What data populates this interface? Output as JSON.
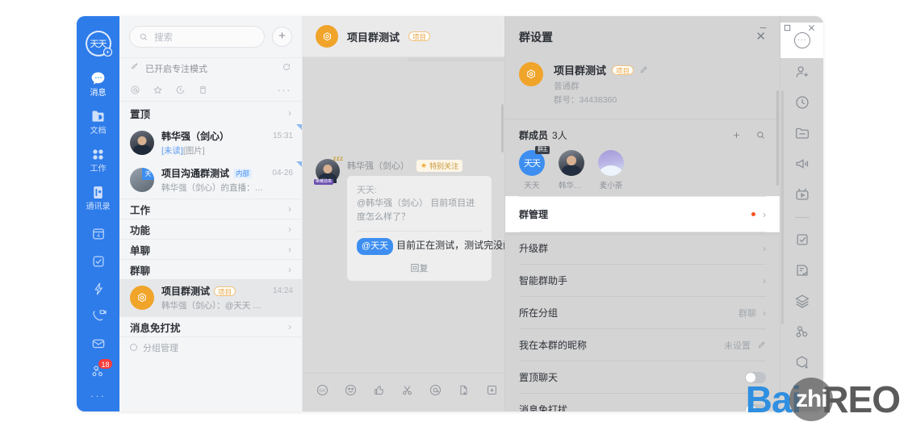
{
  "window": {
    "controls": {
      "minimize": "–",
      "maximize": "□",
      "close": "✕"
    }
  },
  "rail": {
    "avatar_text": "天天",
    "items": [
      {
        "label": "消息",
        "icon": "chat-icon",
        "active": true
      },
      {
        "label": "文档",
        "icon": "docs-icon",
        "active": false
      },
      {
        "label": "工作",
        "icon": "work-grid-icon",
        "active": false
      },
      {
        "label": "通讯录",
        "icon": "contacts-icon",
        "active": false
      }
    ],
    "mini_items": [
      {
        "icon": "calendar-icon",
        "badge": ""
      },
      {
        "icon": "checkbox-task-icon",
        "badge": ""
      },
      {
        "icon": "lightning-icon",
        "badge": ""
      },
      {
        "icon": "video-call-icon",
        "badge": ""
      },
      {
        "icon": "mail-icon",
        "badge": ""
      },
      {
        "icon": "team-icon",
        "badge": "18"
      }
    ],
    "more": "···"
  },
  "chatlist": {
    "search_placeholder": "搜索",
    "add_label": "+",
    "focus_mode": "已开启专注模式",
    "filters": [
      "at-icon",
      "star-icon",
      "clock-icon",
      "archive-icon"
    ],
    "filter_more": "···",
    "pinned_header": "置顶",
    "pinned": [
      {
        "name": "韩华强（剑心）",
        "tag": "",
        "preview_unread": "[未读]",
        "preview": "[图片]",
        "time": "15:31",
        "avatar": "photo1"
      },
      {
        "name": "项目沟通群测试",
        "tag": "内部",
        "preview_unread": "",
        "preview": "韩华强（剑心）的直播：直播测试 已...",
        "time": "04-26",
        "avatar": "photo2"
      }
    ],
    "sections": [
      {
        "label": "工作"
      },
      {
        "label": "功能"
      },
      {
        "label": "单聊"
      },
      {
        "label": "群聊"
      }
    ],
    "selected_chat": {
      "name": "项目群测试",
      "tag": "项目",
      "preview": "韩华强（剑心）：@天天 目前正在测试...",
      "time": "14:24",
      "avatar": "orange-group"
    },
    "dnd_section": "消息免打扰",
    "group_manage": "分组管理"
  },
  "chat": {
    "header": {
      "title": "项目群测试",
      "tag": "项目"
    },
    "message": {
      "sender": "韩华强（剑心）",
      "special_tag": "特别关注",
      "quote_name": "天天:",
      "quote_text": "@韩华强（剑心） 目前项目进度怎么样了？",
      "mention": "@天天",
      "text": "目前正在测试，测试完没问题就能",
      "reply_label": "回复"
    },
    "toolbar": [
      "gif-icon",
      "emoji-icon",
      "thumbs-up-icon",
      "scissors-icon",
      "at-icon",
      "file-send-icon",
      "screenshot-icon",
      "task-check-icon",
      "lightning-icon"
    ]
  },
  "settings": {
    "title": "群设置",
    "close": "✕",
    "group": {
      "name": "项目群测试",
      "tag": "项目",
      "edit_icon": "pencil-icon",
      "type": "普通群",
      "id_label": "群号：34438360"
    },
    "members": {
      "title": "群成员",
      "count": "3人",
      "add_icon": "plus-icon",
      "search_icon": "search-icon",
      "list": [
        {
          "name": "天天",
          "avatar": "tt",
          "owner_badge": "群主"
        },
        {
          "name": "韩华强...",
          "avatar": "p1",
          "owner_badge": ""
        },
        {
          "name": "麦小荼",
          "avatar": "p2",
          "owner_badge": ""
        }
      ]
    },
    "rows": [
      {
        "label": "群管理",
        "value": "",
        "dot": true,
        "chevron": true,
        "highlight": true,
        "toggle": false
      },
      {
        "label": "升级群",
        "value": "",
        "dot": false,
        "chevron": true,
        "highlight": false,
        "toggle": false
      },
      {
        "label": "智能群助手",
        "value": "",
        "dot": false,
        "chevron": true,
        "highlight": false,
        "toggle": false
      },
      {
        "label": "所在分组",
        "value": "群聊",
        "dot": false,
        "chevron": true,
        "highlight": false,
        "toggle": false
      },
      {
        "label": "我在本群的昵称",
        "value": "未设置",
        "dot": false,
        "chevron": false,
        "highlight": false,
        "toggle": false,
        "pencil": true
      },
      {
        "label": "置顶聊天",
        "value": "",
        "dot": false,
        "chevron": false,
        "highlight": false,
        "toggle": true
      },
      {
        "label": "消息免打扰",
        "value": "",
        "dot": false,
        "chevron": false,
        "highlight": false,
        "toggle": true
      }
    ]
  },
  "iconrail": {
    "top_icon": "more-dots-icon",
    "items": [
      "add-member-icon",
      "history-icon",
      "folder-icon",
      "announce-icon",
      "live-tv-icon",
      "SEP",
      "todo-check-icon",
      "approval-icon",
      "layers-icon",
      "org-icon",
      "app-add-icon"
    ]
  },
  "watermark": {
    "part1": "Bai",
    "part2": "zhi",
    "part3": "REO"
  }
}
